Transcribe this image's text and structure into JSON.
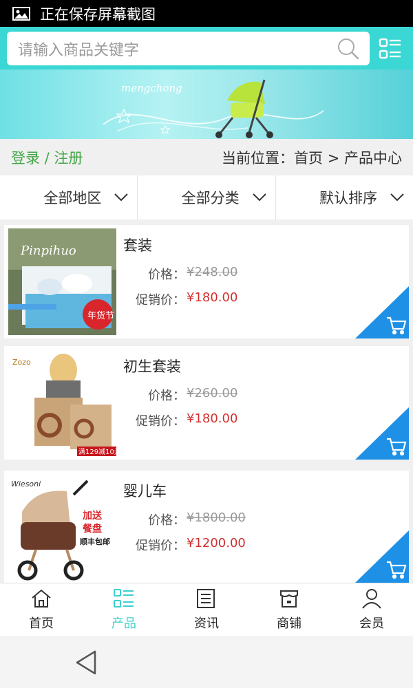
{
  "status_bar": {
    "text": "正在保存屏幕截图",
    "icon": "image-icon"
  },
  "search": {
    "placeholder": "请输入商品关键字",
    "icon": "search-icon"
  },
  "menu": {
    "icon": "list-menu-icon"
  },
  "banner": {
    "text": "mengchong"
  },
  "breadcrumb": {
    "login": "登录 / 注册",
    "location": "当前位置：首页 > 产品中心"
  },
  "filters": [
    {
      "label": "全部地区"
    },
    {
      "label": "全部分类"
    },
    {
      "label": "默认排序"
    }
  ],
  "products": [
    {
      "name": "套装",
      "price_label": "价格：",
      "price": "¥248.00",
      "promo_label": "促销价：",
      "promo_price": "¥180.00",
      "badge": "年货节"
    },
    {
      "name": "初生套装",
      "price_label": "价格：",
      "price": "¥260.00",
      "promo_label": "促销价：",
      "promo_price": "¥180.00",
      "badge": "满129减10元"
    },
    {
      "name": "婴儿车",
      "price_label": "价格：",
      "price": "¥1800.00",
      "promo_label": "促销价：",
      "promo_price": "¥1200.00",
      "badge_top": "加送",
      "badge_mid": "餐盘",
      "badge_sub": "顺丰包邮"
    }
  ],
  "tabs": [
    {
      "label": "首页",
      "icon": "home-icon"
    },
    {
      "label": "产品",
      "icon": "grid-list-icon",
      "active": true
    },
    {
      "label": "资讯",
      "icon": "news-icon"
    },
    {
      "label": "商铺",
      "icon": "shop-icon"
    },
    {
      "label": "会员",
      "icon": "user-icon"
    }
  ],
  "colors": {
    "accent": "#3ad7d4",
    "price_red": "#d32f2f",
    "login_green": "#44a648",
    "cart_blue": "#1e90e6"
  }
}
